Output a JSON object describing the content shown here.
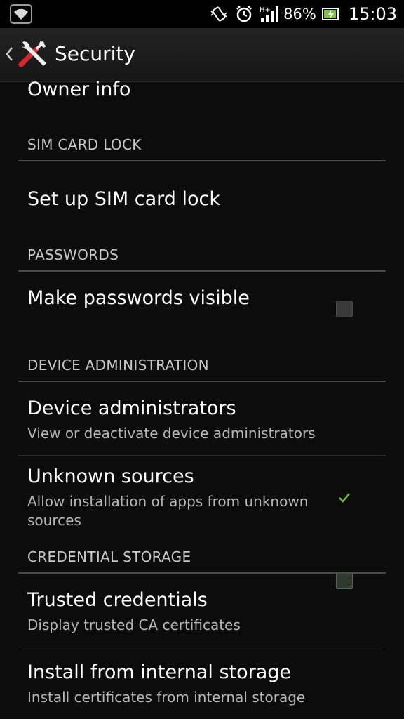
{
  "status_bar": {
    "battery_percent": "86%",
    "time": "15:03",
    "network_type": "H+",
    "icons": [
      "wifi-icon",
      "vibrate-icon",
      "alarm-icon",
      "signal-icon",
      "battery-icon"
    ]
  },
  "action_bar": {
    "title": "Security",
    "icon": "tools-icon"
  },
  "list": {
    "owner_info": {
      "title": "Owner info"
    },
    "sim_card_lock": {
      "header": "SIM CARD LOCK",
      "setup": {
        "title": "Set up SIM card lock"
      }
    },
    "passwords": {
      "header": "PASSWORDS",
      "visible": {
        "title": "Make passwords visible",
        "checked": false
      }
    },
    "device_admin": {
      "header": "DEVICE ADMINISTRATION",
      "administrators": {
        "title": "Device administrators",
        "summary": "View or deactivate device administrators"
      },
      "unknown_sources": {
        "title": "Unknown sources",
        "summary": "Allow installation of apps from unknown sources",
        "checked": true
      }
    },
    "credential_storage": {
      "header": "CREDENTIAL STORAGE",
      "trusted": {
        "title": "Trusted credentials",
        "summary": "Display trusted CA certificates"
      },
      "install": {
        "title": "Install from internal storage",
        "summary": "Install certificates from internal storage"
      }
    }
  },
  "colors": {
    "background": "#0c0c0c",
    "header_rule": "#4a4a4a",
    "check_green": "#6ec23a"
  }
}
